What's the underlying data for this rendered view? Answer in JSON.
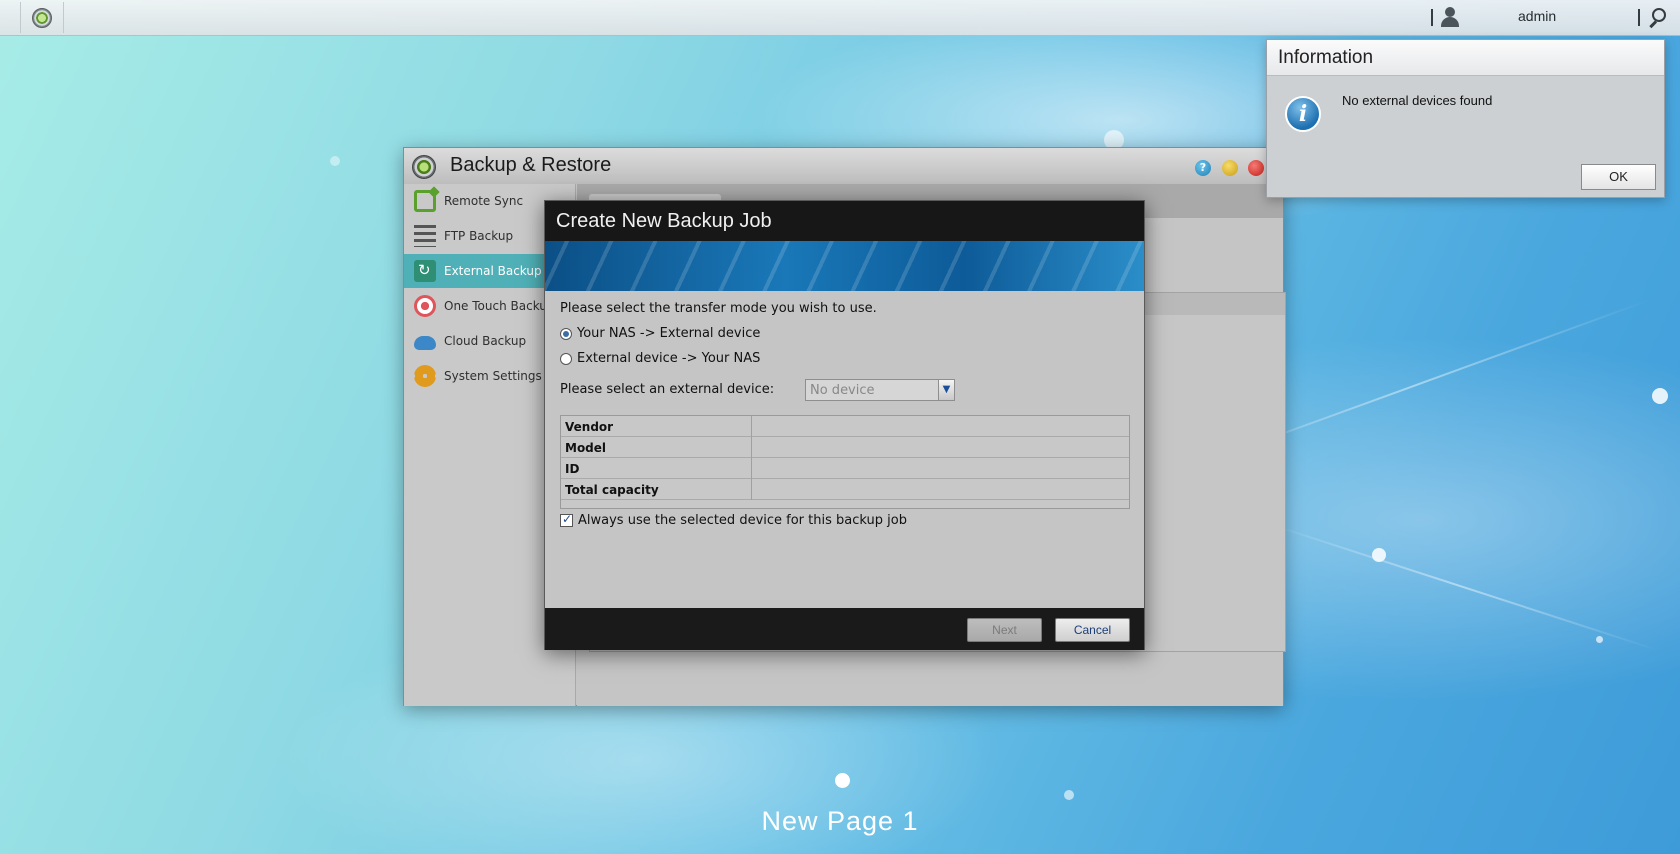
{
  "topbar": {
    "username": "admin"
  },
  "desktop": {
    "page_label": "New Page 1"
  },
  "window": {
    "title": "Backup & Restore",
    "help_symbol": "?",
    "sidebar": {
      "items": [
        {
          "label": "Remote Sync",
          "icon": "remote-sync-icon",
          "active": false
        },
        {
          "label": "FTP Backup",
          "icon": "ftp-icon",
          "active": false
        },
        {
          "label": "External Backup",
          "icon": "external-backup-icon",
          "active": true
        },
        {
          "label": "One Touch Backup",
          "icon": "one-touch-icon",
          "active": false
        },
        {
          "label": "Cloud Backup",
          "icon": "cloud-icon",
          "active": false
        },
        {
          "label": "System Settings",
          "icon": "gear-icon",
          "active": false
        }
      ]
    }
  },
  "dialog": {
    "title": "Create New Backup Job",
    "prompt": "Please select the transfer mode you wish to use.",
    "modes": [
      {
        "label": "Your NAS -> External device",
        "selected": true
      },
      {
        "label": "External device -> Your NAS",
        "selected": false
      }
    ],
    "device_label": "Please select an external device:",
    "device_select": "No device",
    "info_rows": [
      {
        "key": "Vendor",
        "value": ""
      },
      {
        "key": "Model",
        "value": ""
      },
      {
        "key": "ID",
        "value": ""
      },
      {
        "key": "Total capacity",
        "value": ""
      }
    ],
    "always_use_label": "Always use the selected device for this backup job",
    "always_use_checked": true,
    "next_label": "Next",
    "cancel_label": "Cancel"
  },
  "info_popup": {
    "title": "Information",
    "message": "No external devices found",
    "ok_label": "OK"
  },
  "colors": {
    "accent": "#4fb0b7",
    "dialog_header": "#171717",
    "banner": "#1a78b8"
  }
}
